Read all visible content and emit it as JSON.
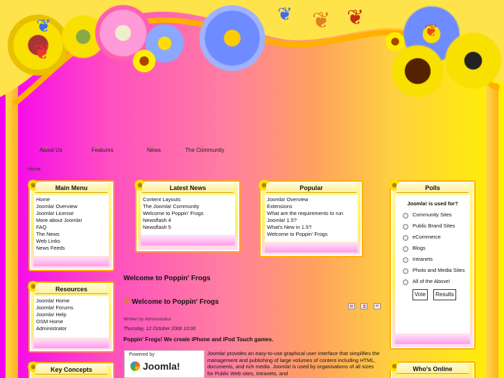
{
  "nav": [
    "About Us",
    "Features",
    "News",
    "The Community"
  ],
  "breadcrumb": "Home",
  "main_menu": {
    "title": "Main Menu",
    "items": [
      "Home",
      "Joomla! Overview",
      "Joomla! License",
      "More about Joomla!",
      "FAQ",
      "The News",
      "Web Links",
      "News Feeds"
    ]
  },
  "resources": {
    "title": "Resources",
    "items": [
      "Joomla! Home",
      "Joomla! Forums",
      "Joomla! Help",
      "OSM Home",
      "Administrator"
    ]
  },
  "key_concepts": {
    "title": "Key Concepts"
  },
  "latest_news": {
    "title": "Latest News",
    "items": [
      "Content Layouts",
      "The Joomla! Community",
      "Welcome to Poppin' Frogs",
      "Newsflash 4",
      "Newsflash 5"
    ]
  },
  "popular": {
    "title": "Popular",
    "items": [
      "Joomla! Overview",
      "Extensions",
      "What are the requirements to run",
      "Joomla! 1.5?",
      "What's New in 1.5?",
      "Welcome to Poppin' Frogs"
    ]
  },
  "polls": {
    "title": "Polls",
    "question": "Joomla! is used for?",
    "options": [
      "Community Sites",
      "Public Brand Sites",
      "eCommerce",
      "Blogs",
      "Intranets",
      "Photo and Media Sites",
      "All of the Above!"
    ],
    "vote_label": "Vote",
    "results_label": "Results"
  },
  "whos_online": {
    "title": "Who's Online"
  },
  "main": {
    "heading": "Welcome to Poppin' Frogs",
    "article_title": "Welcome to Poppin' Frogs",
    "written_by": "Written by Administrator",
    "date": "Thursday, 12 October 2006 10:00",
    "tagline": "Poppin' Frogs! We create iPhone and iPod Touch games.",
    "powered_by": "Powered by",
    "logo_text": "Joomla!",
    "body": "Joomla! provides an easy-to-use graphical user interface that simplifies the management and publishing of large volumes of content including HTML, documents, and rich media. Joomla! is used by organisations of all sizes for Public Web sites, Intranets, and"
  },
  "colors": {
    "magenta": "#f400f0",
    "yellow": "#fff200",
    "frame": "#ffb000"
  }
}
